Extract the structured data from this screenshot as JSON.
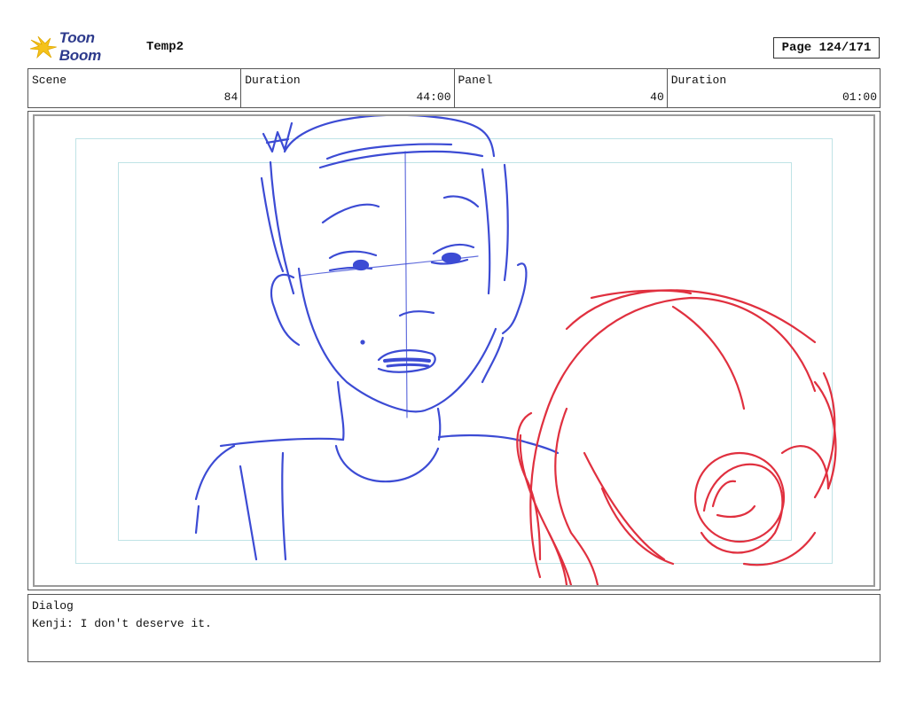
{
  "header": {
    "logo_text": "Toon Boom",
    "project": "Temp2",
    "page": "Page 124/171"
  },
  "info": {
    "scene_label": "Scene",
    "scene_value": "84",
    "scene_duration_label": "Duration",
    "scene_duration_value": "44:00",
    "panel_label": "Panel",
    "panel_value": "40",
    "panel_duration_label": "Duration",
    "panel_duration_value": "01:00"
  },
  "dialog": {
    "label": "Dialog",
    "line": "Kenji: I don't deserve it."
  },
  "sketch": {
    "character_color": "#3c4bd4",
    "second_character_color": "#e0303f",
    "safe_area_color": "#bfe3e6"
  }
}
